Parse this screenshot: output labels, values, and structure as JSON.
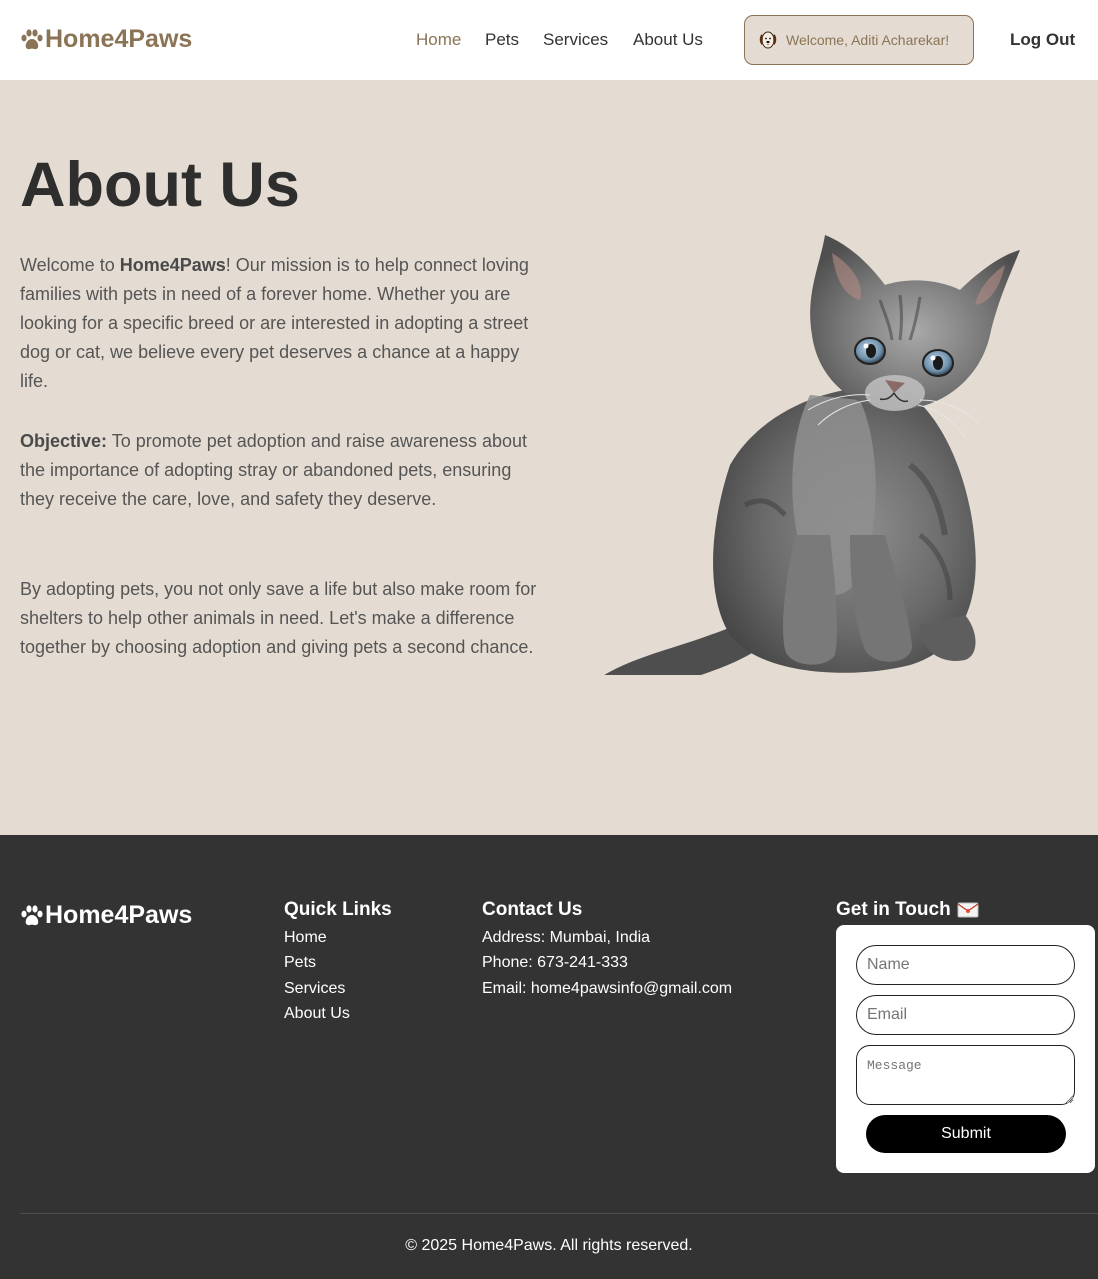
{
  "header": {
    "brand": "Home4Paws",
    "nav": [
      {
        "label": "Home",
        "active": true
      },
      {
        "label": "Pets",
        "active": false
      },
      {
        "label": "Services",
        "active": false
      },
      {
        "label": "About Us",
        "active": false
      }
    ],
    "welcome": "Welcome, Aditi Acharekar!",
    "welcome_icon": "dog-face-icon",
    "logout": "Log Out"
  },
  "about": {
    "title": "About Us",
    "p1_prefix": "Welcome to ",
    "p1_strong": "Home4Paws",
    "p1_rest": "! Our mission is to help connect loving families with pets in need of a forever home. Whether you are looking for a specific breed or are interested in adopting a street dog or cat, we believe every pet deserves a chance at a happy life.",
    "p2_strong": "Objective:",
    "p2_rest": " To promote pet adoption and raise awareness about the importance of adopting stray or abandoned pets, ensuring they receive the care, love, and safety they deserve.",
    "p3": "By adopting pets, you not only save a life but also make room for shelters to help other animals in need. Let's make a difference together by choosing adoption and giving pets a second chance.",
    "image": "kitten-image"
  },
  "footer": {
    "brand": "Home4Paws",
    "quick_links_title": "Quick Links",
    "quick_links": [
      "Home",
      "Pets",
      "Services",
      "About Us"
    ],
    "contact_title": "Contact Us",
    "address": "Address: Mumbai, India",
    "phone": "Phone: 673-241-333",
    "email": "Email: home4pawsinfo@gmail.com",
    "touch_title": "Get in Touch",
    "touch_icon": "envelope-icon",
    "form": {
      "name_placeholder": "Name",
      "email_placeholder": "Email",
      "message_placeholder": "Message",
      "submit": "Submit"
    },
    "copyright": "© 2025 Home4Paws. All rights reserved."
  },
  "colors": {
    "brand": "#8b7355",
    "hero_bg": "#e4dcd2",
    "footer_bg": "#333333"
  }
}
